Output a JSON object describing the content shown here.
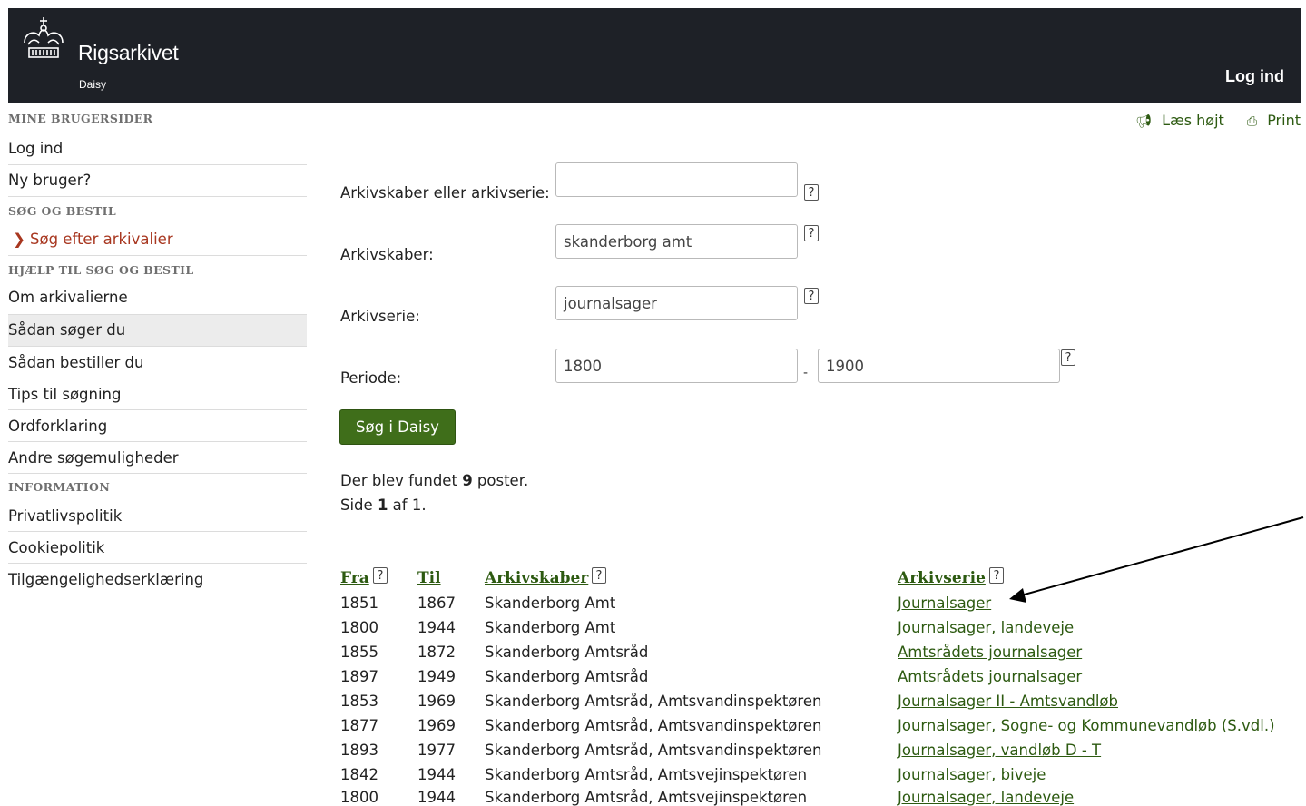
{
  "header": {
    "site_name": "Rigsarkivet",
    "site_sub": "Daisy",
    "login": "Log ind"
  },
  "sidebar": {
    "sections": [
      {
        "heading": "MINE BRUGERSIDER",
        "items": [
          {
            "label": "Log ind"
          },
          {
            "label": "Ny bruger?"
          }
        ]
      },
      {
        "heading": "SØG OG BESTIL",
        "items": [
          {
            "label": "Søg efter arkivalier"
          }
        ]
      },
      {
        "heading": "HJÆLP TIL SØG OG BESTIL",
        "items": [
          {
            "label": "Om arkivalierne"
          },
          {
            "label": "Sådan søger du"
          },
          {
            "label": "Sådan bestiller du"
          },
          {
            "label": "Tips til søgning"
          },
          {
            "label": "Ordforklaring"
          },
          {
            "label": "Andre søgemuligheder"
          }
        ]
      },
      {
        "heading": "INFORMATION",
        "items": [
          {
            "label": "Privatlivspolitik"
          },
          {
            "label": "Cookiepolitik"
          },
          {
            "label": "Tilgængelighedserklæring"
          }
        ]
      }
    ]
  },
  "tools": {
    "read_aloud": "Læs højt",
    "print": "Print"
  },
  "form": {
    "creator_or_series_label": "Arkivskaber eller arkivserie:",
    "creator_or_series_value": "",
    "creator_label": "Arkivskaber:",
    "creator_value": "skanderborg amt",
    "series_label": "Arkivserie:",
    "series_value": "journalsager",
    "period_label": "Periode:",
    "period_from": "1800",
    "period_to": "1900",
    "help_glyph": "?",
    "submit_label": "Søg i Daisy"
  },
  "results": {
    "found_prefix": "Der blev fundet",
    "found_count": "9",
    "found_suffix": "poster.",
    "page_prefix": "Side",
    "page_num": "1",
    "page_suffix": "af 1."
  },
  "table": {
    "headers": {
      "from": "Fra",
      "to": "Til",
      "creator": "Arkivskaber",
      "series": "Arkivserie"
    },
    "rows": [
      {
        "from": "1851",
        "to": "1867",
        "creator": "Skanderborg Amt",
        "series": "Journalsager"
      },
      {
        "from": "1800",
        "to": "1944",
        "creator": "Skanderborg Amt",
        "series": "Journalsager, landeveje"
      },
      {
        "from": "1855",
        "to": "1872",
        "creator": "Skanderborg Amtsråd",
        "series": "Amtsrådets journalsager"
      },
      {
        "from": "1897",
        "to": "1949",
        "creator": "Skanderborg Amtsråd",
        "series": "Amtsrådets journalsager"
      },
      {
        "from": "1853",
        "to": "1969",
        "creator": "Skanderborg Amtsråd, Amtsvandinspektøren",
        "series": "Journalsager II - Amtsvandløb"
      },
      {
        "from": "1877",
        "to": "1969",
        "creator": "Skanderborg Amtsråd, Amtsvandinspektøren",
        "series": "Journalsager, Sogne- og Kommunevandløb (S.vdl.)"
      },
      {
        "from": "1893",
        "to": "1977",
        "creator": "Skanderborg Amtsråd, Amtsvandinspektøren",
        "series": "Journalsager, vandløb D - T"
      },
      {
        "from": "1842",
        "to": "1944",
        "creator": "Skanderborg Amtsråd, Amtsvejinspektøren",
        "series": "Journalsager, biveje"
      },
      {
        "from": "1800",
        "to": "1944",
        "creator": "Skanderborg Amtsråd, Amtsvejinspektøren",
        "series": "Journalsager, landeveje"
      }
    ]
  },
  "colors": {
    "header_bg": "#1e2127",
    "link_green": "#2d5a11",
    "button_green": "#3f6e1a",
    "accent_red": "#a83720"
  }
}
